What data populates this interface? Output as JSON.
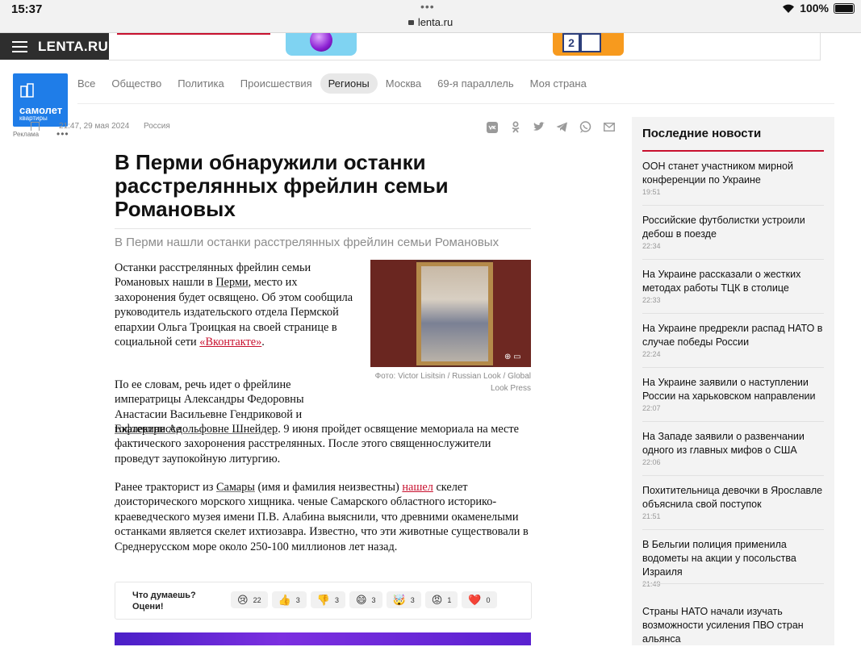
{
  "status": {
    "time": "15:37",
    "url": "lenta.ru",
    "battery": "100%"
  },
  "site": {
    "logo": "LENTA.RU"
  },
  "ad": {
    "brand": "самолет",
    "sub": "квартиры",
    "label": "Реклама",
    "game_tile": "2"
  },
  "nav": [
    "Все",
    "Общество",
    "Политика",
    "Происшествия",
    "Регионы",
    "Москва",
    "69-я параллель",
    "Моя страна"
  ],
  "nav_active": "Регионы",
  "article": {
    "date": "21:47, 29 мая 2024",
    "category": "Россия",
    "title": "В Перми обнаружили останки расстрелянных фрейлин семьи Романовых",
    "subtitle": "В Перми нашли останки расстрелянных фрейлин семьи Романовых",
    "caption": "Фото: Victor Lisitsin / Russian Look / Global Look Press",
    "p1": {
      "a": "Останки расстрелянных фрейлин семьи Романовых нашли в ",
      "link1": "Перми",
      "b": ", место их захоронения будет освящено. Об этом сообщила руководитель издательского отдела Пермской епархии Ольга Троицкая на своей странице в социальной сети ",
      "link2": "«Вконтакте»",
      "c": "."
    },
    "p2": {
      "a": "По ее словам, речь идет о фрейлине императрицы Александры Федоровны Анастасии Васильевне Гендриковой и гофлектриссе ",
      "link1": "Екатерине Адольфовне Шнейдер",
      "b": ". 9 июня пройдет освящение мемориала на месте фактического захоронения расстрелянных. После этого священнослужители проведут заупокойную литургию."
    },
    "p3": {
      "a": "Ранее тракторист из ",
      "link1": "Самары",
      "b": " (имя и фамилия неизвестны) ",
      "link2": "нашел",
      "c": " скелет доисторического морского хищника. ченые Самарского областного историко-краеведческого музея имени П.В. Алабина выяснили, что древними окаменелыми останками является скелет ихтиозавра. Известно, что эти животные существовали в Среднерусском море около 250-100 миллионов лет назад."
    }
  },
  "reactions": {
    "question": "Что думаешь? Оцени!",
    "items": [
      {
        "emoji": "😢",
        "count": "22"
      },
      {
        "emoji": "👍",
        "count": "3"
      },
      {
        "emoji": "👎",
        "count": "3"
      },
      {
        "emoji": "😄",
        "count": "3"
      },
      {
        "emoji": "🤯",
        "count": "3"
      },
      {
        "emoji": "😡",
        "count": "1"
      },
      {
        "emoji": "❤️",
        "count": "0"
      }
    ]
  },
  "share_icons": [
    "vk-icon",
    "ok-icon",
    "twitter-icon",
    "telegram-icon",
    "whatsapp-icon",
    "mail-icon"
  ],
  "sidebar": {
    "title": "Последние новости",
    "news": [
      {
        "title": "ООН станет участником мирной конференции по Украине",
        "time": "19:51"
      },
      {
        "title": "Российские футболистки устроили дебош в поезде",
        "time": "22:34"
      },
      {
        "title": "На Украине рассказали о жестких методах работы ТЦК в столице",
        "time": "22:33"
      },
      {
        "title": "На Украине предрекли распад НАТО в случае победы России",
        "time": "22:24"
      },
      {
        "title": "На Украине заявили о наступлении России на харьковском направлении",
        "time": "22:07"
      },
      {
        "title": "На Западе заявили о развенчании одного из главных мифов о США",
        "time": "22:06"
      },
      {
        "title": "Похитительница девочки в Ярославле объяснила свой поступок",
        "time": "21:51"
      },
      {
        "title": "В Бельгии полиция применила водометы на акции у посольства Израиля",
        "time": "21:49"
      },
      {
        "title": "Страны НАТО начали изучать возможности усиления ПВО стран альянса",
        "time": ""
      }
    ]
  },
  "colors": {
    "accent": "#c8102e",
    "ad_blue": "#1f7de8",
    "header_dark": "#2e2e2e"
  }
}
